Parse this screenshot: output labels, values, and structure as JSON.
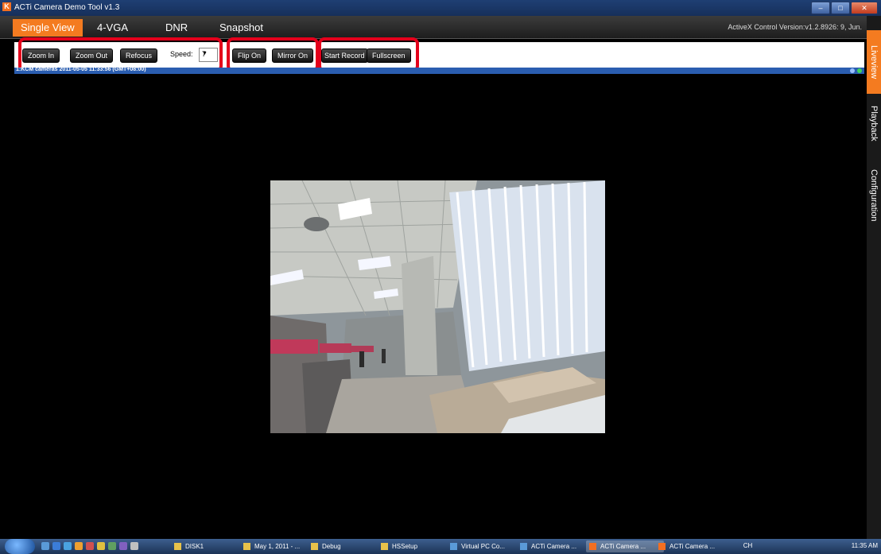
{
  "window": {
    "title": "ACTi Camera Demo Tool v1.3",
    "icon_letter": "K",
    "controls": [
      "minimize-icon",
      "maximize-icon",
      "close-icon"
    ]
  },
  "tabs": [
    {
      "label": "Single View",
      "active": true
    },
    {
      "label": "4-VGA",
      "active": false
    },
    {
      "label": "DNR",
      "active": false
    },
    {
      "label": "Snapshot",
      "active": false
    }
  ],
  "activex_version": "ActiveX Control Version:v1.2.8926: 9, Jun.",
  "side_tabs": [
    {
      "label": "Liveview",
      "active": true
    },
    {
      "label": "Playback",
      "active": false
    },
    {
      "label": "Configuration",
      "active": false
    }
  ],
  "toolbar": {
    "zoom_in": "Zoom In",
    "zoom_out": "Zoom Out",
    "refocus": "Refocus",
    "speed_label": "Speed:",
    "speed_value": "7",
    "flip_on": "Flip On",
    "mirror_on": "Mirror On",
    "start_record": "Start Record",
    "fullscreen": "Fullscreen"
  },
  "view": {
    "title": "1:KCM cameras  2011-05-05 11:33:56 (GMT+08:00)"
  },
  "highlight_color": "#e4001b",
  "accent_color": "#f47b20",
  "taskbar": {
    "items": [
      {
        "label": "DISK1",
        "kind": "folder",
        "active": false
      },
      {
        "label": "May 1, 2011 - ...",
        "kind": "folder",
        "active": false
      },
      {
        "label": "Debug",
        "kind": "folder",
        "active": false
      },
      {
        "label": "HSSetup",
        "kind": "folder",
        "active": false
      },
      {
        "label": "Virtual PC Co...",
        "kind": "vpc",
        "active": false
      },
      {
        "label": "ACTi Camera ...",
        "kind": "vpc",
        "active": false
      },
      {
        "label": "ACTi Camera ...",
        "kind": "acti",
        "active": true
      },
      {
        "label": "ACTi Camera ...",
        "kind": "acti",
        "active": false
      }
    ],
    "lang": "CH",
    "clock": "11:35 AM"
  }
}
